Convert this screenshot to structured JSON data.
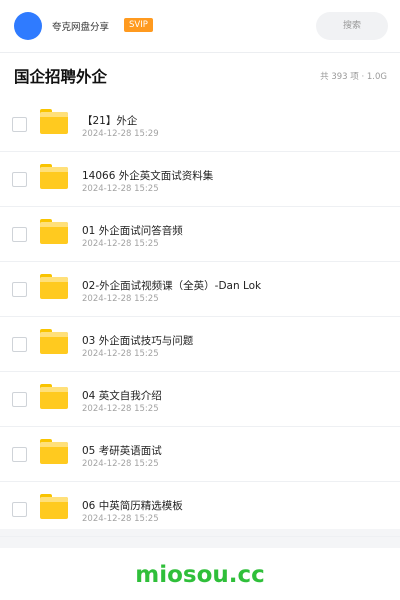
{
  "header": {
    "username": "夸克网盘分享",
    "badge": "SVIP",
    "search_placeholder": "搜索"
  },
  "title_bar": {
    "title": "国企招聘外企",
    "meta": "共 393 项 · 1.0G"
  },
  "files": [
    {
      "name": "【21】外企",
      "date": "2024-12-28 15:29"
    },
    {
      "name": "14066 外企英文面试资料集",
      "date": "2024-12-28 15:25"
    },
    {
      "name": "01 外企面试问答音频",
      "date": "2024-12-28 15:25"
    },
    {
      "name": "02-外企面试视频课（全英）-Dan Lok",
      "date": "2024-12-28 15:25"
    },
    {
      "name": "03 外企面试技巧与问题",
      "date": "2024-12-28 15:25"
    },
    {
      "name": "04 英文自我介绍",
      "date": "2024-12-28 15:25"
    },
    {
      "name": "05 考研英语面试",
      "date": "2024-12-28 15:25"
    },
    {
      "name": "06 中英简历精选模板",
      "date": "2024-12-28 15:25"
    }
  ],
  "watermark": "miosou.cc",
  "colors": {
    "avatar": "#2f7bff",
    "badge": "#ff9a1f",
    "folder": "#ffca1f",
    "watermark": "#2fbf3a"
  }
}
